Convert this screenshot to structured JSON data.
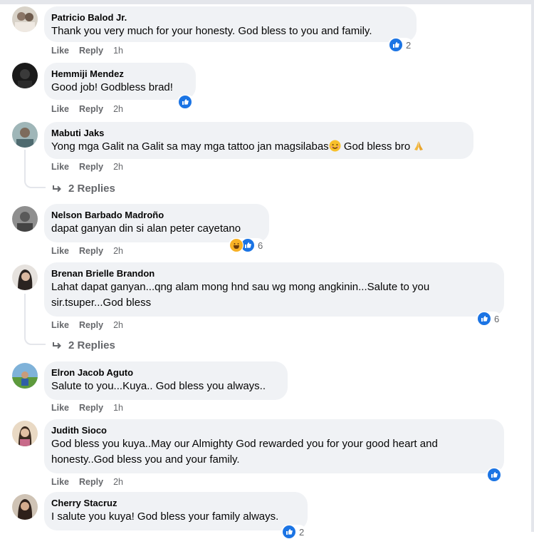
{
  "labels": {
    "like": "Like",
    "reply": "Reply"
  },
  "colors": {
    "bubble": "#f0f2f5",
    "meta": "#65676b",
    "like_blue": "#1b74e4",
    "haha": "#f7b125"
  },
  "comments": [
    {
      "author": "Patricio Balod Jr.",
      "text": "Thank you very much for your honesty. God bless to you and family.",
      "time": "1h",
      "reactions": [
        "like"
      ],
      "reaction_count": "2"
    },
    {
      "author": "Hemmiji Mendez",
      "text": "Good job! Godbless brad!",
      "time": "2h",
      "reactions": [
        "like"
      ],
      "reaction_count": ""
    },
    {
      "author": "Mabuti Jaks",
      "text": "Yong mga Galit na Galit sa may mga tattoo jan magsilabas",
      "text_tail": " God bless bro ",
      "emoji": [
        "smiling-face-emoji",
        "folded-hands-emoji"
      ],
      "time": "2h",
      "replies": "2 Replies"
    },
    {
      "author": "Nelson Barbado Madroño",
      "text": "dapat ganyan din si alan peter cayetano",
      "time": "2h",
      "reactions": [
        "haha",
        "like"
      ],
      "reaction_count": "6"
    },
    {
      "author": "Brenan Brielle Brandon",
      "text_line1": "Lahat dapat ganyan...qng alam mong hnd sau wg mong angkinin...Salute to you",
      "text_line2": "sir.tsuper...God bless",
      "time": "2h",
      "reactions": [
        "like"
      ],
      "reaction_count": "6",
      "replies": "2 Replies"
    },
    {
      "author": "Elron Jacob Aguto",
      "text": "Salute to you...Kuya.. God bless you always..",
      "time": "1h"
    },
    {
      "author": "Judith Sioco",
      "text_line1": "God bless you kuya..May our Almighty God rewarded you for your good heart and",
      "text_line2": "honesty..God bless you and your family.",
      "time": "2h",
      "reactions": [
        "like"
      ],
      "reaction_count": ""
    },
    {
      "author": "Cherry Stacruz",
      "text": "I salute you kuya! God bless your family always.",
      "time": "",
      "reactions": [
        "like"
      ],
      "reaction_count": "2"
    }
  ]
}
